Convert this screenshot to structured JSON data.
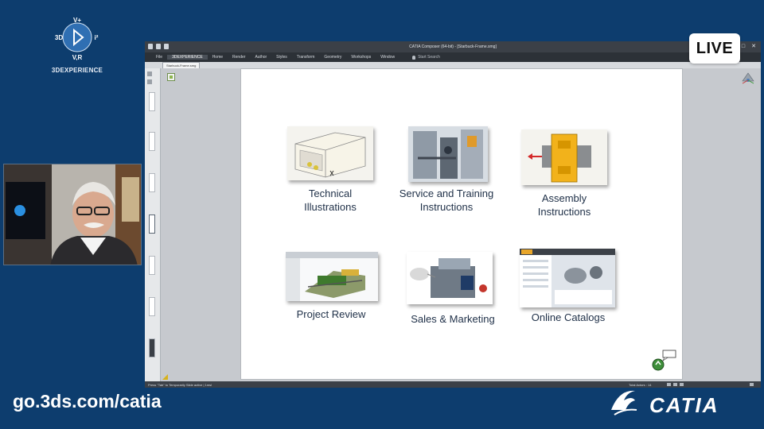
{
  "brand": {
    "compass_letters": {
      "top": "V+",
      "left": "3D",
      "right": "i²",
      "bottom": "V,R"
    },
    "name": "3DEXPERIENCE"
  },
  "app": {
    "window_title": "CATIA Composer (64-bit) - [Starbuck-Frame.smg]",
    "menu": [
      "File",
      "3DEXPERIENCE",
      "Home",
      "Render",
      "Author",
      "Styles",
      "Transform",
      "Geometry",
      "Workshops",
      "Window"
    ],
    "active_menu": "3DEXPERIENCE",
    "tell_me": "Start Search",
    "doc_tab": "Starbuck-Frame.smg",
    "status_left": "Press \"Tab\" to Temporarily Slide active | 1msl",
    "status_right": "Total Actors : 14"
  },
  "slide": {
    "cards": [
      {
        "label": "Technical\nIllustrations"
      },
      {
        "label": "Service and Training\nInstructions"
      },
      {
        "label": "Assembly\nInstructions"
      },
      {
        "label": "Project Review"
      },
      {
        "label": "Sales & Marketing"
      },
      {
        "label": "Online Catalogs"
      }
    ]
  },
  "live_badge": "LIVE",
  "footer": {
    "url": "go.3ds.com/catia",
    "product": "CATIA"
  },
  "colors": {
    "background": "#0d3d6e",
    "slide_text": "#1e2f47",
    "assembly_yellow": "#f2b21b"
  },
  "icons": [
    "compass-logo",
    "3ds-logo",
    "axis-compass-icon",
    "tree-icon",
    "save-icon",
    "undo-icon",
    "redo-icon",
    "lightbulb-icon"
  ]
}
